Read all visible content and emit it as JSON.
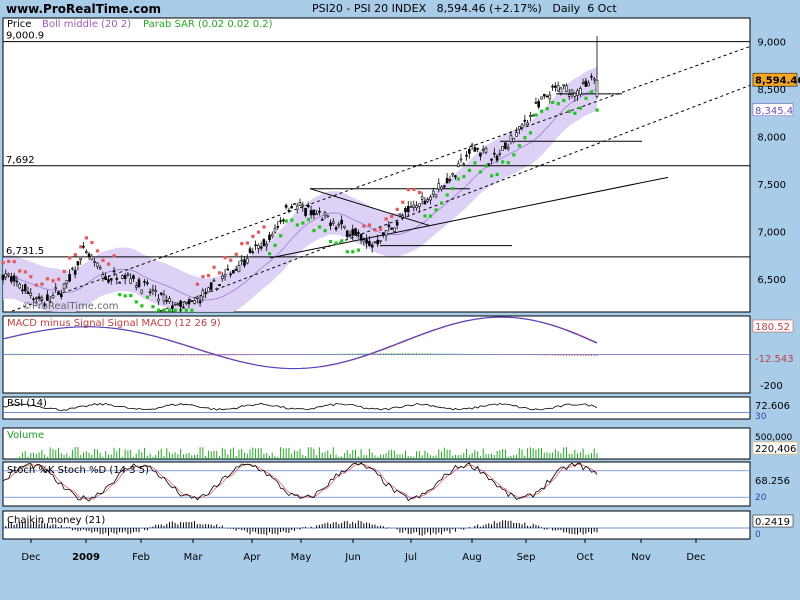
{
  "header": {
    "site": "www.ProRealTime.com",
    "symbol": "PSI20 - PSI 20 INDEX",
    "last": "8,594.46",
    "change": "(+2.17%)",
    "period": "Daily",
    "date": "6 Oct"
  },
  "watermark": "©ProRealTime.com",
  "colors": {
    "frame": "#a9cce8",
    "panel": "#ffffff",
    "bull": "#000000",
    "bear": "#000000",
    "sar_bull": "#22c422",
    "sar_bear": "#e05a5a",
    "boll": "#d9cdf5",
    "macd": "#4040d0",
    "signal": "#e06666",
    "hist": "#22aa22",
    "volume": "#22aa22"
  },
  "chart_data": [
    {
      "panel": "price",
      "type": "candlestick",
      "title": "Price",
      "legend": [
        "Price",
        "Boll middle (20 2)",
        "Parab SAR (0.02 0.02 0.2)"
      ],
      "x_ticks": [
        "Dec",
        "2009",
        "Feb",
        "Mar",
        "Apr",
        "May",
        "Jun",
        "Jul",
        "Aug",
        "Sep",
        "Oct",
        "Nov",
        "Dec"
      ],
      "y_ticks": [
        "9,000",
        "8,500",
        "8,000",
        "7,500",
        "7,000",
        "6,500"
      ],
      "ylim": [
        6150,
        9250
      ],
      "levels": [
        {
          "label": "9,000.9",
          "value": 9000.9
        },
        {
          "label": "7,692",
          "value": 7692
        },
        {
          "label": "6,731.5",
          "value": 6731.5
        }
      ],
      "last_label": "8,594.46",
      "last_value": 8594.46,
      "sar_label": "8,345.4",
      "sar_value": 8345.4,
      "close_path": [
        [
          0,
          6550
        ],
        [
          0.03,
          6400
        ],
        [
          0.06,
          6250
        ],
        [
          0.09,
          6400
        ],
        [
          0.12,
          6800
        ],
        [
          0.15,
          6500
        ],
        [
          0.18,
          6550
        ],
        [
          0.21,
          6400
        ],
        [
          0.24,
          6250
        ],
        [
          0.27,
          6200
        ],
        [
          0.3,
          6350
        ],
        [
          0.33,
          6550
        ],
        [
          0.36,
          6750
        ],
        [
          0.39,
          6900
        ],
        [
          0.42,
          7300
        ],
        [
          0.45,
          7200
        ],
        [
          0.48,
          7100
        ],
        [
          0.51,
          7000
        ],
        [
          0.54,
          6850
        ],
        [
          0.57,
          7050
        ],
        [
          0.6,
          7250
        ],
        [
          0.63,
          7400
        ],
        [
          0.66,
          7600
        ],
        [
          0.69,
          7900
        ],
        [
          0.72,
          7750
        ],
        [
          0.75,
          8000
        ],
        [
          0.78,
          8300
        ],
        [
          0.81,
          8500
        ],
        [
          0.84,
          8480
        ],
        [
          0.87,
          8594
        ]
      ]
    },
    {
      "panel": "macd",
      "type": "line",
      "title": "MACD minus Signal Signal MACD (12 26 9)",
      "series": [
        "MACD minus Signal",
        "Signal",
        "MACD (12 26 9)"
      ],
      "values_labels": [
        "180.52",
        "-12.543"
      ],
      "y_ticks": [
        "-200"
      ],
      "ylim": [
        -250,
        250
      ]
    },
    {
      "panel": "rsi",
      "type": "line",
      "title": "RSI (14)",
      "last_label": "72.606",
      "y_ticks": [
        "30"
      ],
      "ylim": [
        0,
        100
      ]
    },
    {
      "panel": "volume",
      "type": "bar",
      "title": "Volume",
      "last_label": "220,406",
      "y_ticks": [
        "500,000"
      ]
    },
    {
      "panel": "stoch",
      "type": "line",
      "title": "Stoch %K Stoch %D (14 3 5)",
      "last_label": "68.256",
      "y_ticks": [
        "20"
      ],
      "ylim": [
        0,
        100
      ]
    },
    {
      "panel": "chaikin",
      "type": "bar",
      "title": "Chaikin money (21)",
      "last_label": "0.2419",
      "y_ticks": [
        "0"
      ]
    }
  ]
}
